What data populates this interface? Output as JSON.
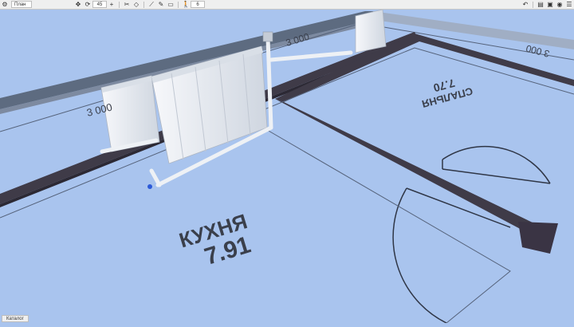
{
  "toolbar": {
    "view_select": "План",
    "rotate_value": "45",
    "people_value": "6",
    "icons": [
      "settings-icon",
      "move-icon",
      "rotate-icon",
      "plus-icon",
      "cut-icon",
      "hide-icon",
      "wall-tool-icon",
      "window-icon",
      "walk-icon",
      "undo-icon",
      "chat-icon",
      "save-icon",
      "camera-icon",
      "menu-icon"
    ]
  },
  "scene": {
    "rooms": [
      {
        "name": "КУХНЯ",
        "area": "7.91"
      },
      {
        "name": "СПАЛЬНЯ",
        "area": "7.70"
      }
    ],
    "dimensions": [
      "3 000",
      "3 000",
      "3 000"
    ],
    "colors": {
      "floor": "#a9c4ee",
      "wall": "#3f3b48",
      "wall_top": "#5a6478",
      "radiator": "#e7ebf1",
      "pipe": "#f2f4f7"
    }
  },
  "footer": {
    "catalog_label": "Каталог"
  }
}
